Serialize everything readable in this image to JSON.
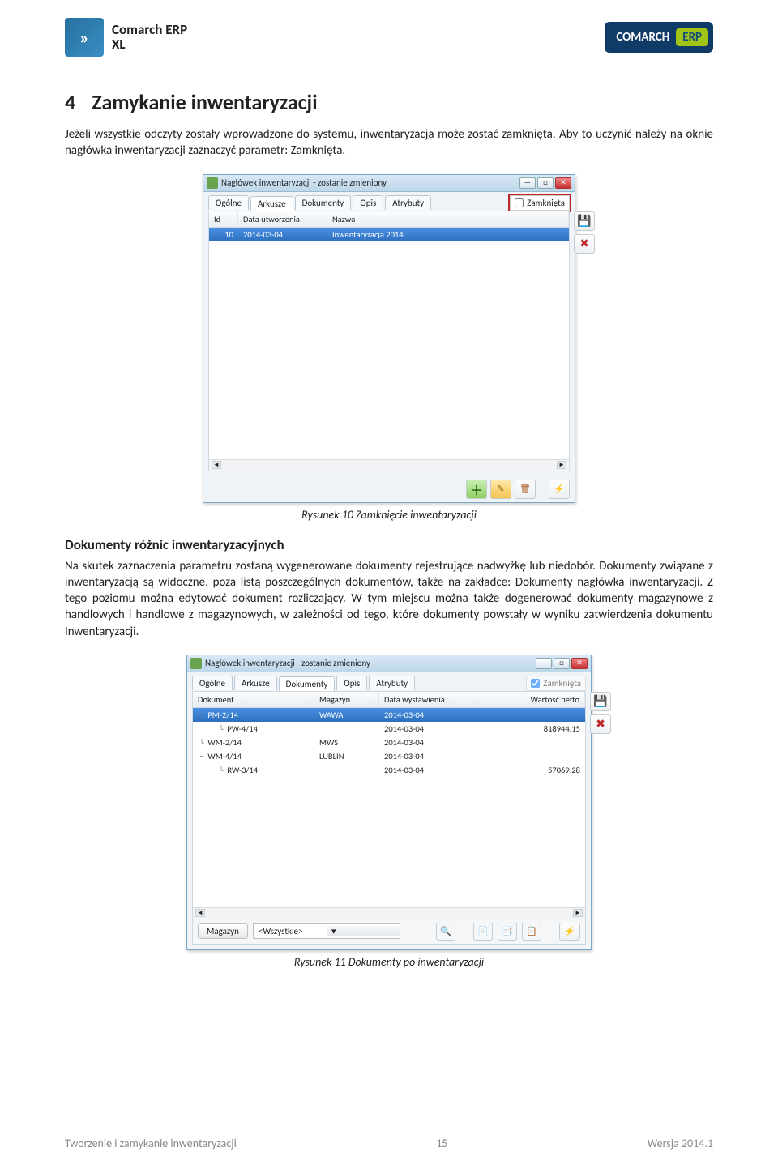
{
  "header": {
    "logo_text_line1": "Comarch ERP",
    "logo_text_line2": "XL",
    "badge_left": "COMARCH",
    "badge_right": "ERP"
  },
  "section": {
    "number": "4",
    "title": "Zamykanie inwentaryzacji"
  },
  "para1": "Jeżeli wszystkie odczyty zostały wprowadzone do systemu, inwentaryzacja może zostać zamknięta. Aby to uczynić należy na oknie nagłówka inwentaryzacji zaznaczyć parametr: Zamknięta.",
  "win1": {
    "title": "Nagłówek inwentaryzacji - zostanie zmieniony",
    "tabs": [
      "Ogólne",
      "Arkusze",
      "Dokumenty",
      "Opis",
      "Atrybuty"
    ],
    "active_tab": "Arkusze",
    "checkbox_label": "Zamknięta",
    "cols": {
      "id": "Id",
      "date": "Data utworzenia",
      "name": "Nazwa"
    },
    "row": {
      "id": "10",
      "date": "2014-03-04",
      "name": "Inwentaryzacja 2014"
    }
  },
  "caption1": "Rysunek 10 Zamknięcie inwentaryzacji",
  "subhead": "Dokumenty różnic inwentaryzacyjnych",
  "para2": "Na skutek zaznaczenia parametru zostaną wygenerowane dokumenty rejestrujące nadwyżkę lub niedobór. Dokumenty związane z inwentaryzacją są widoczne, poza listą poszczególnych dokumentów, także na zakładce: Dokumenty nagłówka inwentaryzacji. Z tego poziomu można edytować dokument rozliczający. W tym miejscu można także dogenerować dokumenty magazynowe z handlowych i handlowe z magazynowych, w zależności od tego, które dokumenty powstały w wyniku zatwierdzenia dokumentu Inwentaryzacji.",
  "win2": {
    "title": "Nagłówek inwentaryzacji - zostanie zmieniony",
    "tabs": [
      "Ogólne",
      "Arkusze",
      "Dokumenty",
      "Opis",
      "Atrybuty"
    ],
    "active_tab": "Dokumenty",
    "checkbox_label": "Zamknięta",
    "cols": {
      "doc": "Dokument",
      "mag": "Magazyn",
      "date": "Data wystawienia",
      "val": "Wartość netto"
    },
    "rows": [
      {
        "doc": "PM-2/14",
        "mag": "WAWA",
        "date": "2014-03-04",
        "val": "",
        "lvl": 0,
        "sel": true,
        "exp": "−"
      },
      {
        "doc": "PW-4/14",
        "mag": "",
        "date": "2014-03-04",
        "val": "818944.15",
        "lvl": 1
      },
      {
        "doc": "WM-2/14",
        "mag": "MWS",
        "date": "2014-03-04",
        "val": "",
        "lvl": 0
      },
      {
        "doc": "WM-4/14",
        "mag": "LUBLIN",
        "date": "2014-03-04",
        "val": "",
        "lvl": 0,
        "exp": "−"
      },
      {
        "doc": "RW-3/14",
        "mag": "",
        "date": "2014-03-04",
        "val": "57069.28",
        "lvl": 1
      }
    ],
    "footer_btn": "Magazyn",
    "footer_combo": "<Wszystkie>"
  },
  "caption2": "Rysunek 11 Dokumenty po inwentaryzacji",
  "footer": {
    "left": "Tworzenie i zamykanie inwentaryzacji",
    "center": "15",
    "right": "Wersja 2014.1"
  }
}
